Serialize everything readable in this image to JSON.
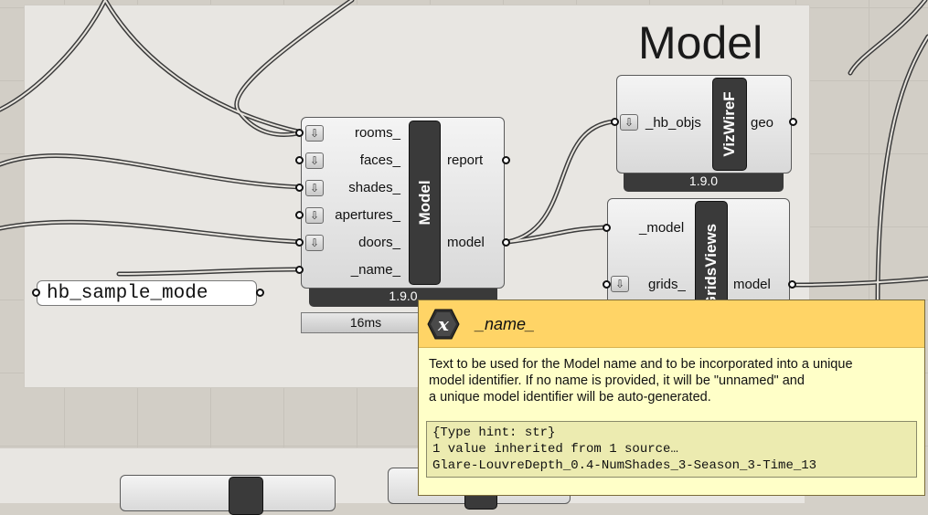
{
  "group": {
    "title": "Model"
  },
  "model_component": {
    "nickname": "Model",
    "inputs": [
      "rooms_",
      "faces_",
      "shades_",
      "apertures_",
      "doors_",
      "_name_"
    ],
    "outputs": [
      "report",
      "model"
    ],
    "version": "1.9.0",
    "timer": "16ms"
  },
  "vizwire_component": {
    "nickname": "VizWireF",
    "inputs": [
      "_hb_objs"
    ],
    "outputs": [
      "geo"
    ],
    "version": "1.9.0"
  },
  "gridsviews_component": {
    "nickname": "GridsViews",
    "inputs": [
      "_model",
      "grids_"
    ],
    "outputs": [
      "model"
    ]
  },
  "panel": {
    "text": "hb_sample_mode"
  },
  "tooltip": {
    "title": "_name_",
    "description_lines": [
      "Text to be used for the Model name and to be incorporated into a unique",
      "model identifier. If no name is provided, it will be \"unnamed\" and",
      "a unique model identifier will be auto-generated."
    ],
    "hint_lines": [
      "{Type hint: str}",
      "1 value inherited from 1 source…",
      "Glare-LouvreDepth_0.4-NumShades_3-Season_3-Time_13"
    ]
  },
  "colors": {
    "tooltip_header": "#ffd466",
    "tooltip_body": "#ffffc8",
    "component_dark": "#3a3a3a"
  },
  "icons": {
    "tooltip_icon": "x-param-icon",
    "input_arrow": "down-arrow-icon"
  }
}
